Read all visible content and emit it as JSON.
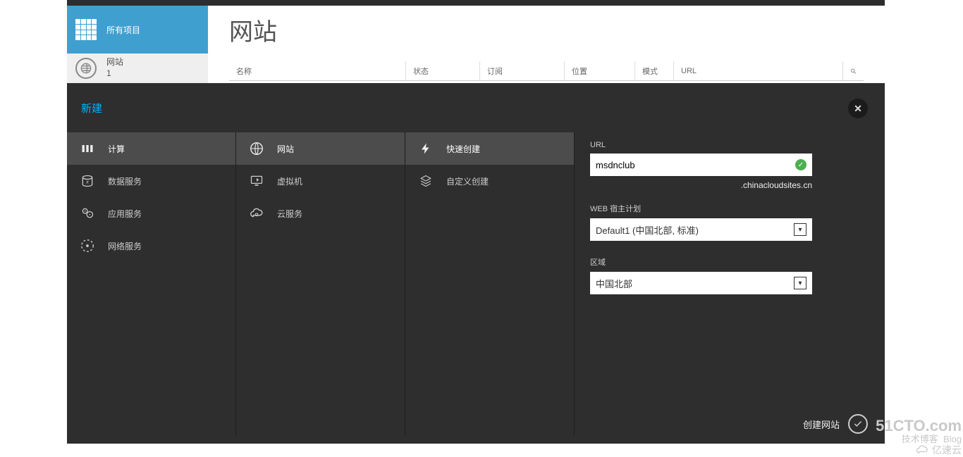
{
  "sidebar": {
    "all_items_label": "所有项目",
    "websites_label": "网站",
    "websites_count": "1"
  },
  "page": {
    "title": "网站",
    "columns": {
      "name": "名称",
      "state": "状态",
      "subscription": "订阅",
      "location": "位置",
      "mode": "模式",
      "url": "URL"
    }
  },
  "drawer": {
    "title": "新建",
    "col1": [
      {
        "label": "计算",
        "icon": "compute-icon",
        "selected": true
      },
      {
        "label": "数据服务",
        "icon": "data-icon",
        "selected": false
      },
      {
        "label": "应用服务",
        "icon": "app-icon",
        "selected": false
      },
      {
        "label": "网络服务",
        "icon": "network-icon",
        "selected": false
      }
    ],
    "col2": [
      {
        "label": "网站",
        "icon": "website-icon",
        "selected": true
      },
      {
        "label": "虚拟机",
        "icon": "vm-icon",
        "selected": false
      },
      {
        "label": "云服务",
        "icon": "cloud-icon",
        "selected": false
      }
    ],
    "col3": [
      {
        "label": "快速创建",
        "icon": "quick-icon",
        "selected": true
      },
      {
        "label": "自定义创建",
        "icon": "custom-icon",
        "selected": false
      }
    ],
    "form": {
      "url_label": "URL",
      "url_value": "msdnclub",
      "url_suffix": ".chinacloudsites.cn",
      "plan_label": "WEB 宿主计划",
      "plan_value": "Default1 (中国北部, 标准)",
      "region_label": "区域",
      "region_value": "中国北部",
      "submit_label": "创建网站"
    }
  },
  "watermark": {
    "line1": "51CTO.com",
    "line2_a": "技术博客",
    "line2_b": "Blog",
    "brand2": "亿速云"
  }
}
